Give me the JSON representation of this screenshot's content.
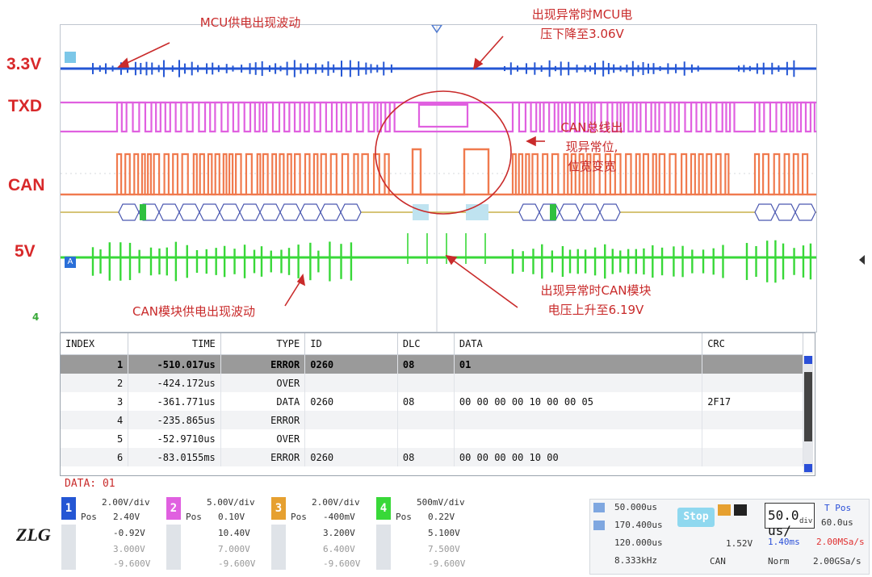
{
  "annotations": {
    "mcu_power": "MCU供电出现波动",
    "mcu_drop_l1": "出现异常时MCU电",
    "mcu_drop_l2": "压下降至3.06V",
    "can_bus_l1": "CAN总线出",
    "can_bus_l2": "现异常位,",
    "can_bus_l3": "位宽变宽",
    "can_rise_l1": "出现异常时CAN模块",
    "can_rise_l2": "电压上升至6.19V",
    "can_power": "CAN模块供电出现波动"
  },
  "channel_labels": {
    "v33": "3.3V",
    "txd": "TXD",
    "can": "CAN",
    "v5": "5V",
    "ch4_marker": "4"
  },
  "colors": {
    "ch1": "#2456d4",
    "ch2": "#e060e0",
    "ch3": "#f07a4e",
    "ch4": "#38d838",
    "annotation": "#c92b2b"
  },
  "decode_table": {
    "headers": [
      "INDEX",
      "TIME",
      "TYPE",
      "ID",
      "DLC",
      "DATA",
      "CRC"
    ],
    "rows": [
      {
        "index": "1",
        "time": "-510.017us",
        "type": "ERROR",
        "id": "0260",
        "dlc": "08",
        "data": "01",
        "crc": ""
      },
      {
        "index": "2",
        "time": "-424.172us",
        "type": "OVER",
        "id": "",
        "dlc": "",
        "data": "",
        "crc": ""
      },
      {
        "index": "3",
        "time": "-361.771us",
        "type": "DATA",
        "id": "0260",
        "dlc": "08",
        "data": "00 00 00 00 10 00 00 05",
        "crc": "2F17"
      },
      {
        "index": "4",
        "time": "-235.865us",
        "type": "ERROR",
        "id": "",
        "dlc": "",
        "data": "",
        "crc": ""
      },
      {
        "index": "5",
        "time": "-52.9710us",
        "type": "OVER",
        "id": "",
        "dlc": "",
        "data": "",
        "crc": ""
      },
      {
        "index": "6",
        "time": "-83.0155ms",
        "type": "ERROR",
        "id": "0260",
        "dlc": "08",
        "data": "00 00 00 00 10 00",
        "crc": ""
      }
    ]
  },
  "data_label": "DATA: 01",
  "channels": [
    {
      "num": "1",
      "scale": "2.00V/div",
      "pos_label": "Pos",
      "pos": "2.40V",
      "row2": "-0.92V",
      "row3": "3.000V",
      "row4": "-9.600V"
    },
    {
      "num": "2",
      "scale": "5.00V/div",
      "pos_label": "Pos",
      "pos": "0.10V",
      "row2": "10.40V",
      "row3": "7.000V",
      "row4": "-9.600V"
    },
    {
      "num": "3",
      "scale": "2.00V/div",
      "pos_label": "Pos",
      "pos": "-400mV",
      "row2": "3.200V",
      "row3": "6.400V",
      "row4": "-9.600V"
    },
    {
      "num": "4",
      "scale": "500mV/div",
      "pos_label": "Pos",
      "pos": "0.22V",
      "row2": "5.100V",
      "row3": "7.500V",
      "row4": "-9.600V"
    }
  ],
  "status": {
    "row1": "50.000us",
    "row2": "170.400us",
    "row3": "120.000us",
    "row4": "8.333kHz",
    "stop": "Stop",
    "trigger_level": "1.52V",
    "trigger_source": "CAN",
    "timebase": "50.0 us/",
    "timebase_unit": "div",
    "t_pos": "T Pos",
    "t_val": "60.0us",
    "sample1": "1.40ms",
    "sample2": "2.00MSa/s",
    "mode": "Norm",
    "rate": "2.00GSa/s"
  },
  "logo": "ZLG"
}
